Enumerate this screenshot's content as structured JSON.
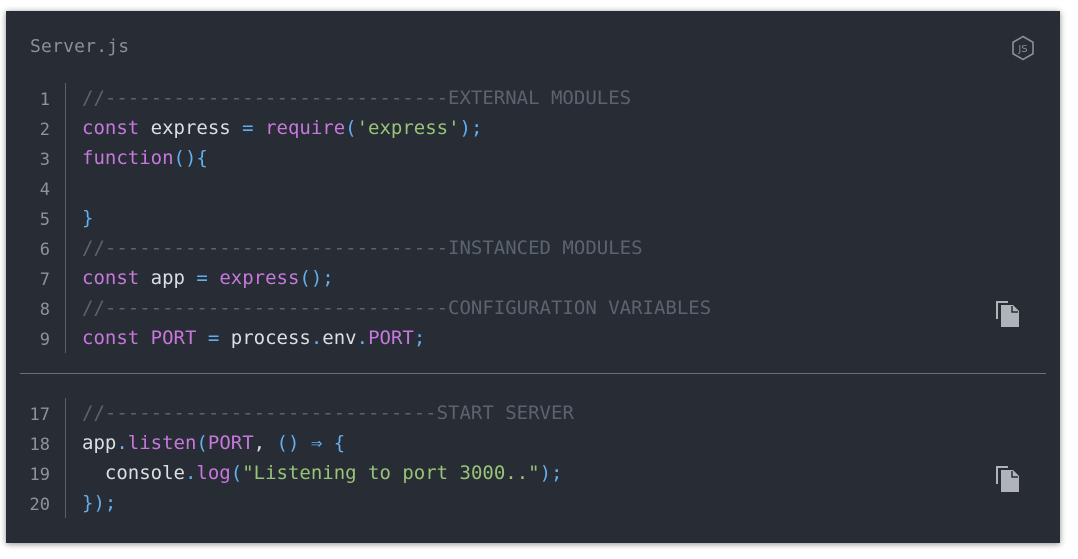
{
  "header": {
    "filename": "Server.js",
    "language_icon": "js-icon"
  },
  "block1": {
    "lines": [
      {
        "num": "1",
        "tokens": [
          {
            "t": "//------------------------------",
            "c": "com"
          },
          {
            "t": "EXTERNAL MODULES",
            "c": "com"
          }
        ]
      },
      {
        "num": "2",
        "tokens": [
          {
            "t": "const",
            "c": "kw"
          },
          {
            "t": " express ",
            "c": "plain"
          },
          {
            "t": "=",
            "c": "punc"
          },
          {
            "t": " ",
            "c": "plain"
          },
          {
            "t": "require",
            "c": "fn"
          },
          {
            "t": "(",
            "c": "punc"
          },
          {
            "t": "'express'",
            "c": "str"
          },
          {
            "t": ");",
            "c": "punc"
          }
        ]
      },
      {
        "num": "3",
        "tokens": [
          {
            "t": "function",
            "c": "kw"
          },
          {
            "t": "(){",
            "c": "punc"
          }
        ]
      },
      {
        "num": "4",
        "tokens": []
      },
      {
        "num": "5",
        "tokens": [
          {
            "t": "}",
            "c": "punc"
          }
        ]
      },
      {
        "num": "6",
        "tokens": [
          {
            "t": "//------------------------------",
            "c": "com"
          },
          {
            "t": "INSTANCED MODULES",
            "c": "com"
          }
        ]
      },
      {
        "num": "7",
        "tokens": [
          {
            "t": "const",
            "c": "kw"
          },
          {
            "t": " app ",
            "c": "plain"
          },
          {
            "t": "=",
            "c": "punc"
          },
          {
            "t": " ",
            "c": "plain"
          },
          {
            "t": "express",
            "c": "fn"
          },
          {
            "t": "();",
            "c": "punc"
          }
        ]
      },
      {
        "num": "8",
        "tokens": [
          {
            "t": "//------------------------------",
            "c": "com"
          },
          {
            "t": "CONFIGURATION VARIABLES",
            "c": "com"
          }
        ]
      },
      {
        "num": "9",
        "tokens": [
          {
            "t": "const",
            "c": "kw"
          },
          {
            "t": " ",
            "c": "plain"
          },
          {
            "t": "PORT",
            "c": "cst"
          },
          {
            "t": " ",
            "c": "plain"
          },
          {
            "t": "=",
            "c": "punc"
          },
          {
            "t": " process",
            "c": "plain"
          },
          {
            "t": ".",
            "c": "punc"
          },
          {
            "t": "env",
            "c": "plain"
          },
          {
            "t": ".",
            "c": "punc"
          },
          {
            "t": "PORT",
            "c": "cst"
          },
          {
            "t": ";",
            "c": "punc"
          }
        ]
      }
    ]
  },
  "block2": {
    "lines": [
      {
        "num": "17",
        "tokens": [
          {
            "t": "//-----------------------------",
            "c": "com"
          },
          {
            "t": "START SERVER",
            "c": "com"
          }
        ]
      },
      {
        "num": "18",
        "tokens": [
          {
            "t": "app",
            "c": "plain"
          },
          {
            "t": ".",
            "c": "punc"
          },
          {
            "t": "listen",
            "c": "fn"
          },
          {
            "t": "(",
            "c": "punc"
          },
          {
            "t": "PORT",
            "c": "cst"
          },
          {
            "t": ", ",
            "c": "plain"
          },
          {
            "t": "() ⇒ {",
            "c": "punc"
          }
        ]
      },
      {
        "num": "19",
        "tokens": [
          {
            "t": "  console",
            "c": "plain"
          },
          {
            "t": ".",
            "c": "punc"
          },
          {
            "t": "log",
            "c": "fn"
          },
          {
            "t": "(",
            "c": "punc"
          },
          {
            "t": "\"Listening to port 3000..\"",
            "c": "str"
          },
          {
            "t": ");",
            "c": "punc"
          }
        ]
      },
      {
        "num": "20",
        "tokens": [
          {
            "t": "});",
            "c": "punc"
          }
        ]
      }
    ]
  },
  "actions": {
    "copy_icon": "copy-icon"
  }
}
